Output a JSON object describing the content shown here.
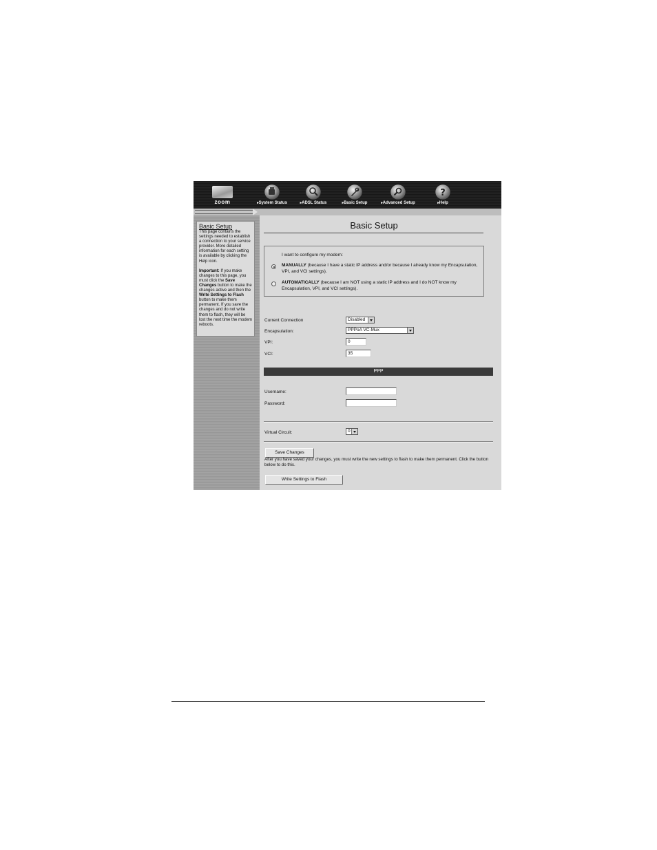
{
  "nav": {
    "logo_text": "zoom",
    "items": [
      {
        "label": "System Status",
        "icon": "system-status-icon"
      },
      {
        "label": "ADSL Status",
        "icon": "adsl-status-icon"
      },
      {
        "label": "Basic Setup",
        "icon": "basic-setup-icon"
      },
      {
        "label": "Advanced Setup",
        "icon": "advanced-setup-icon"
      },
      {
        "label": "Help",
        "icon": "help-icon"
      }
    ]
  },
  "sidebar": {
    "title": "Basic Setup",
    "intro": "This page contains the settings needed to establish a connection to your service provider. More detailed information for each setting is available by clicking the Help icon.",
    "important_label": "Important:",
    "imp_1": " If you make changes to this page, you must click the ",
    "save_ref": "Save Changes",
    "imp_2": " button to make the changes active and then the ",
    "write_ref": "Write Settings to Flash",
    "imp_3": " button to make them permanent. If you save the changes and do not write them to flash, they will be lost the next time the modem reboots."
  },
  "main": {
    "title": "Basic Setup",
    "config_prompt": "I want to configure my modem:",
    "manual": {
      "label": "MANUALLY",
      "desc": " (because I have a static IP address and/or because I already know my Encapsulation, VPI, and VCI settings).",
      "selected": true
    },
    "automatic": {
      "label": "AUTOMATICALLY",
      "desc": " (because I am NOT using a static IP address and I do NOT know my Encapsulation, VPI, and VCI settings).",
      "selected": false
    },
    "current_connection_label": "Current Connection",
    "current_connection_value": "Disabled",
    "encapsulation_label": "Encapsulation:",
    "encapsulation_value": "PPPoA VC-Mux",
    "vpi_label": "VPI:",
    "vpi_value": "0",
    "vci_label": "VCI:",
    "vci_value": "35",
    "ppp_header": "PPP",
    "username_label": "Username:",
    "username_value": "",
    "password_label": "Password:",
    "password_value": "",
    "virtual_circuit_label": "Virtual Circuit:",
    "virtual_circuit_value": "0",
    "save_button": "Save Changes",
    "flash_note": "After you have saved your changes, you must write the new settings to flash to make them permanent. Click the button below to do this.",
    "write_button": "Write Settings to Flash"
  }
}
